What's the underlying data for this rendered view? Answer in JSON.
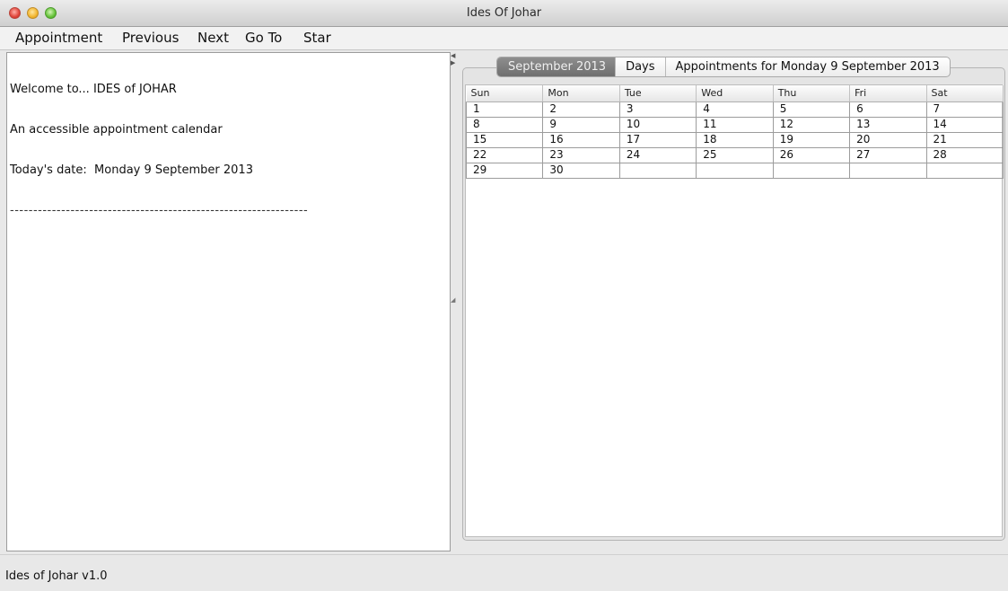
{
  "window": {
    "title": "Ides Of Johar"
  },
  "menubar": {
    "appointment": "Appointment",
    "previous": "Previous",
    "next": "Next",
    "goto": "Go To",
    "star": "Star"
  },
  "left_panel": {
    "lines": [
      "Welcome to... IDES of JOHAR",
      "An accessible appointment calendar",
      "Today's date:  Monday 9 September 2013",
      "----------------------------------------------------------------"
    ]
  },
  "tabs": [
    {
      "label": "September 2013",
      "active": true
    },
    {
      "label": "Days",
      "active": false
    },
    {
      "label": "Appointments for Monday 9 September 2013",
      "active": false
    }
  ],
  "calendar": {
    "headers": [
      "Sun",
      "Mon",
      "Tue",
      "Wed",
      "Thu",
      "Fri",
      "Sat"
    ],
    "rows": [
      [
        "1",
        "2",
        "3",
        "4",
        "5",
        "6",
        "7"
      ],
      [
        "8",
        "9",
        "10",
        "11",
        "12",
        "13",
        "14"
      ],
      [
        "15",
        "16",
        "17",
        "18",
        "19",
        "20",
        "21"
      ],
      [
        "22",
        "23",
        "24",
        "25",
        "26",
        "27",
        "28"
      ],
      [
        "29",
        "30",
        "",
        "",
        "",
        "",
        ""
      ]
    ]
  },
  "status": {
    "text": "Ides of Johar v1.0"
  },
  "colors": {
    "active_tab": "#7f7f7f",
    "close": "#e0443a",
    "minimize": "#f2b52e",
    "maximize": "#66c33a"
  }
}
